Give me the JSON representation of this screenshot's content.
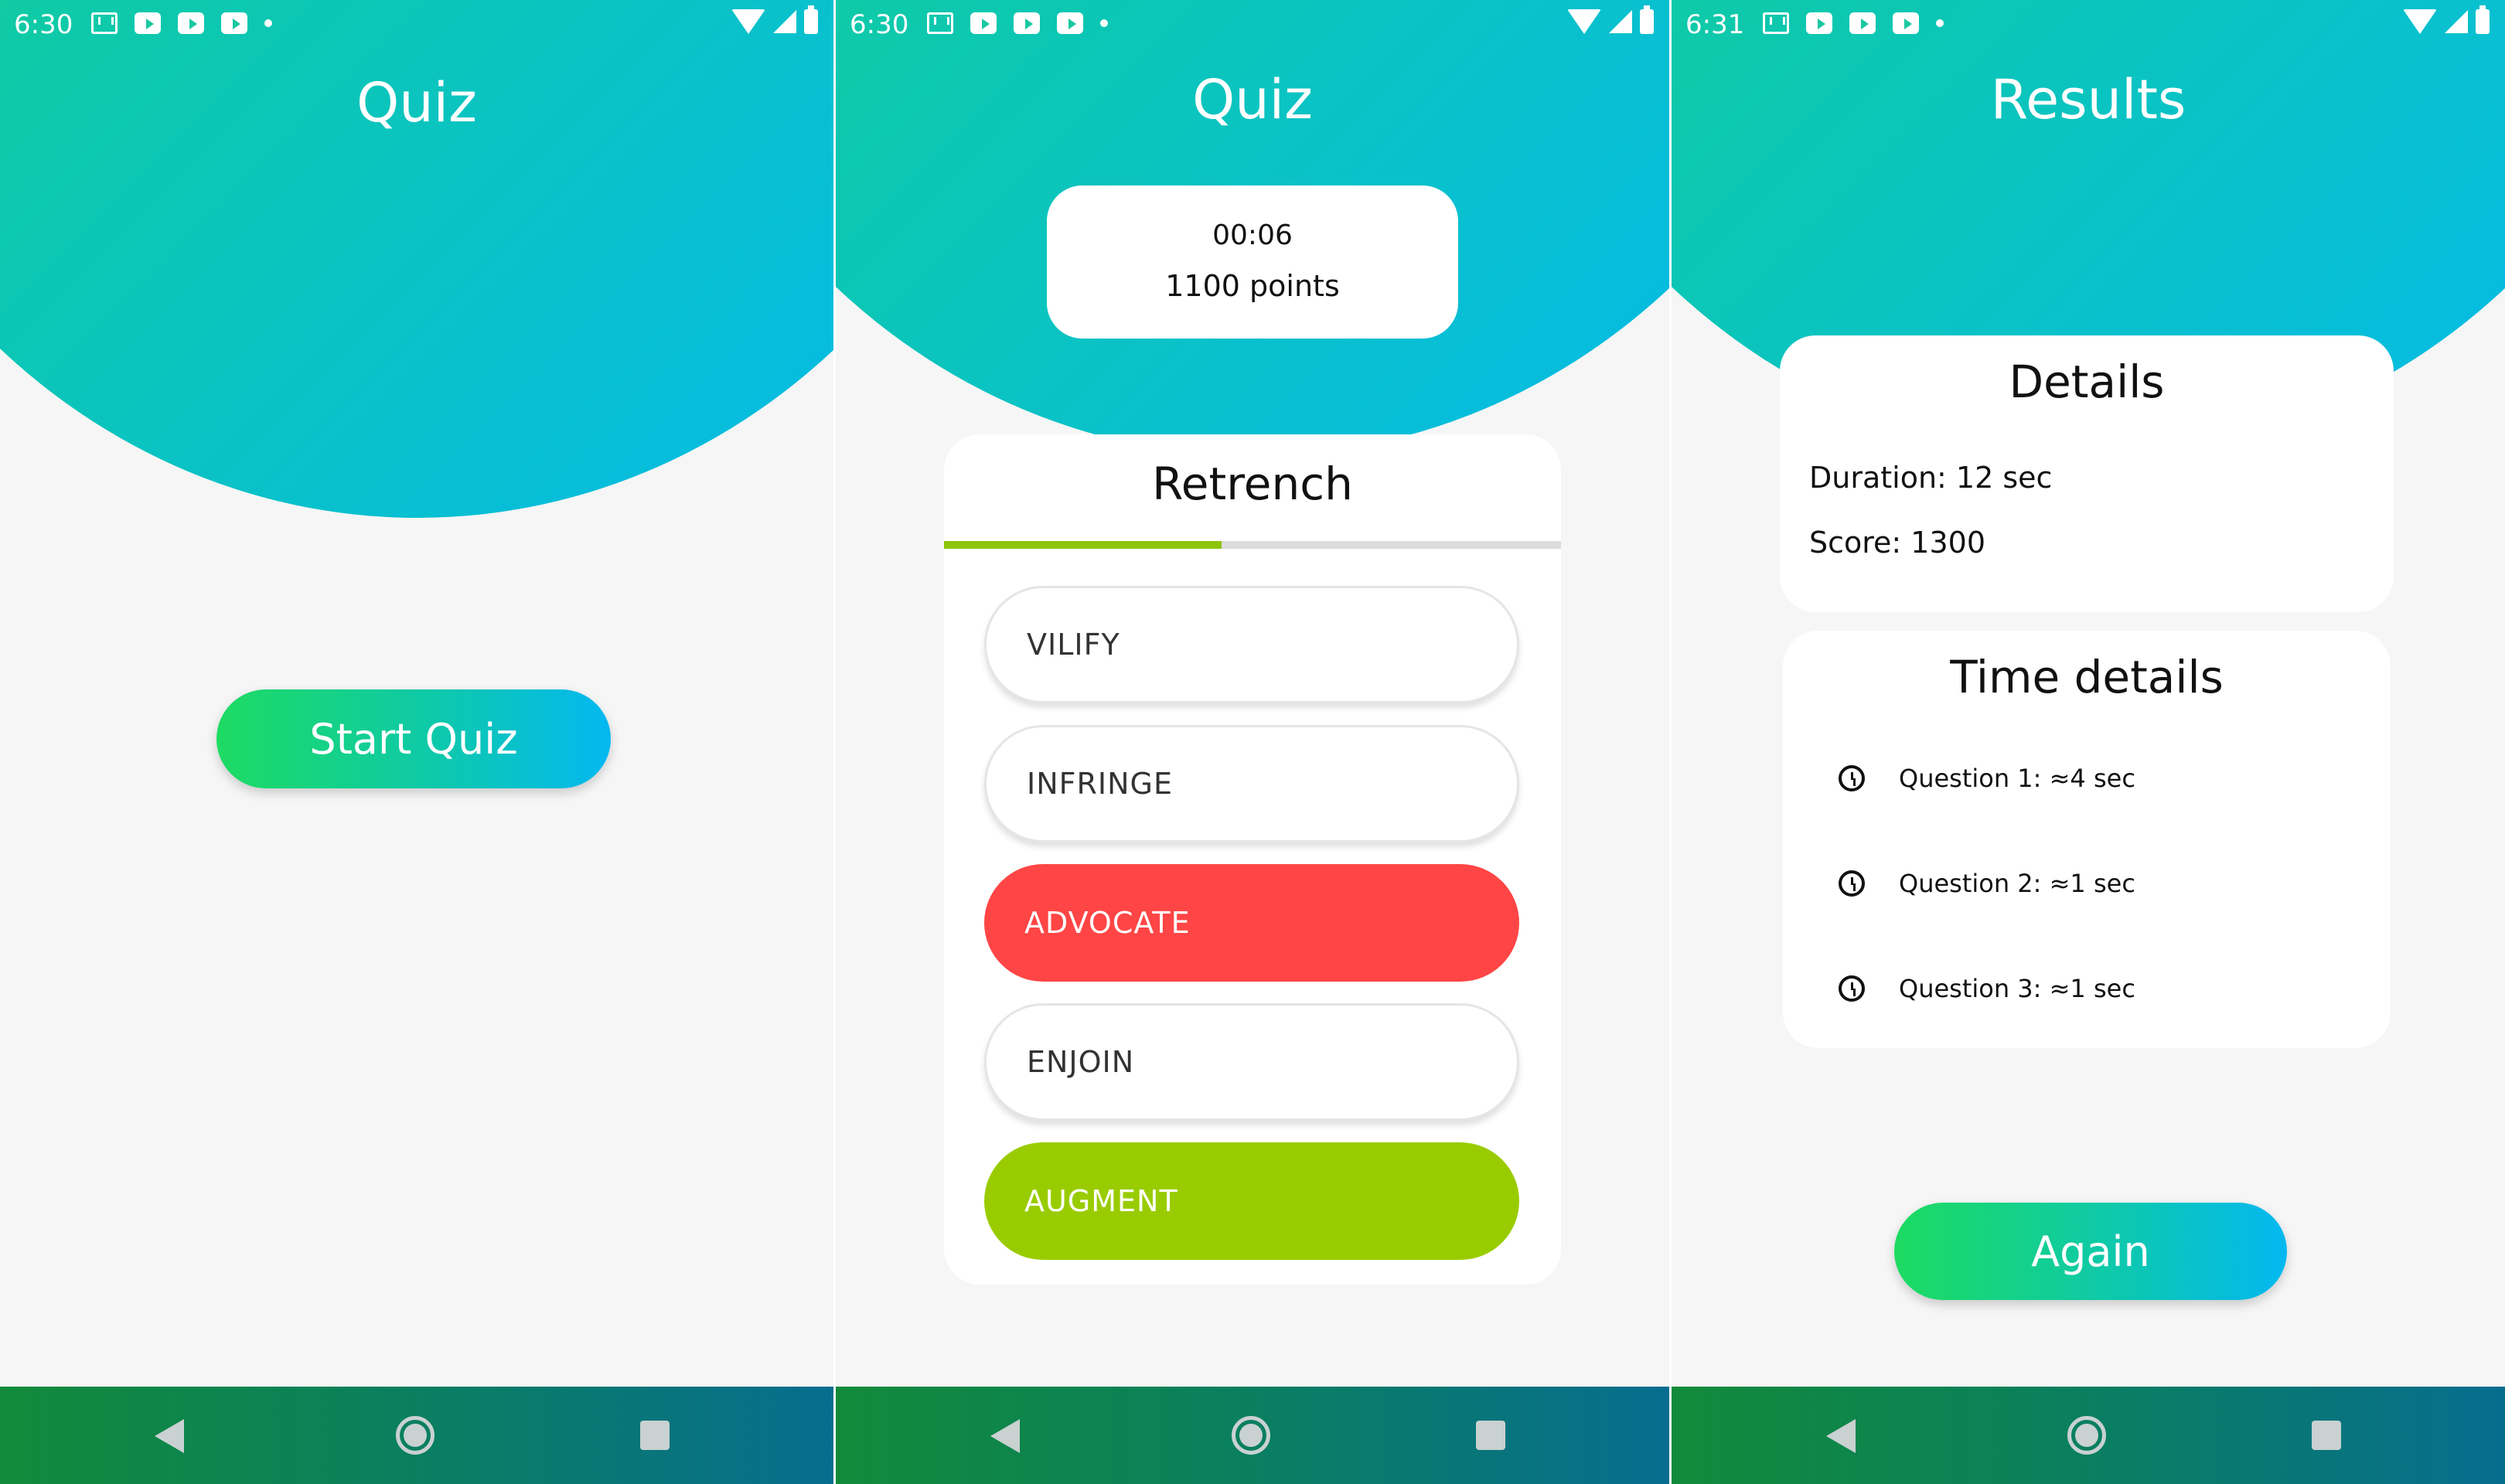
{
  "screen1": {
    "status_time": "6:30",
    "title": "Quiz",
    "start_label": "Start Quiz"
  },
  "screen2": {
    "status_time": "6:30",
    "title": "Quiz",
    "timer": "00:06",
    "points": "1100 points",
    "word": "Retrench",
    "progress_fraction": 0.45,
    "options": [
      {
        "label": "VILIFY",
        "state": "normal"
      },
      {
        "label": "INFRINGE",
        "state": "normal"
      },
      {
        "label": "ADVOCATE",
        "state": "wrong"
      },
      {
        "label": "ENJOIN",
        "state": "normal"
      },
      {
        "label": "AUGMENT",
        "state": "correct"
      }
    ]
  },
  "screen3": {
    "status_time": "6:31",
    "title": "Results",
    "details_title": "Details",
    "duration": "Duration: 12 sec",
    "score": "Score: 1300",
    "time_details_title": "Time details",
    "questions": [
      {
        "label": "Question 1: ≈4 sec"
      },
      {
        "label": "Question 2: ≈1 sec"
      },
      {
        "label": "Question 3: ≈1 sec"
      }
    ],
    "again_label": "Again"
  },
  "colors": {
    "gradient_start": "#1ddb61",
    "gradient_end": "#03b8f1",
    "wrong": "#ff4545",
    "correct": "#99cc00",
    "progress": "#8cc40c",
    "navbar": "#0a7f60"
  },
  "icons": {
    "statusbar": [
      "gmail-icon",
      "youtube-icon",
      "youtube-icon",
      "youtube-icon",
      "dot-icon",
      "wifi-icon",
      "signal-icon",
      "battery-icon"
    ],
    "navbar": [
      "back-icon",
      "home-icon",
      "recents-icon"
    ],
    "time_details": "clock-icon"
  }
}
